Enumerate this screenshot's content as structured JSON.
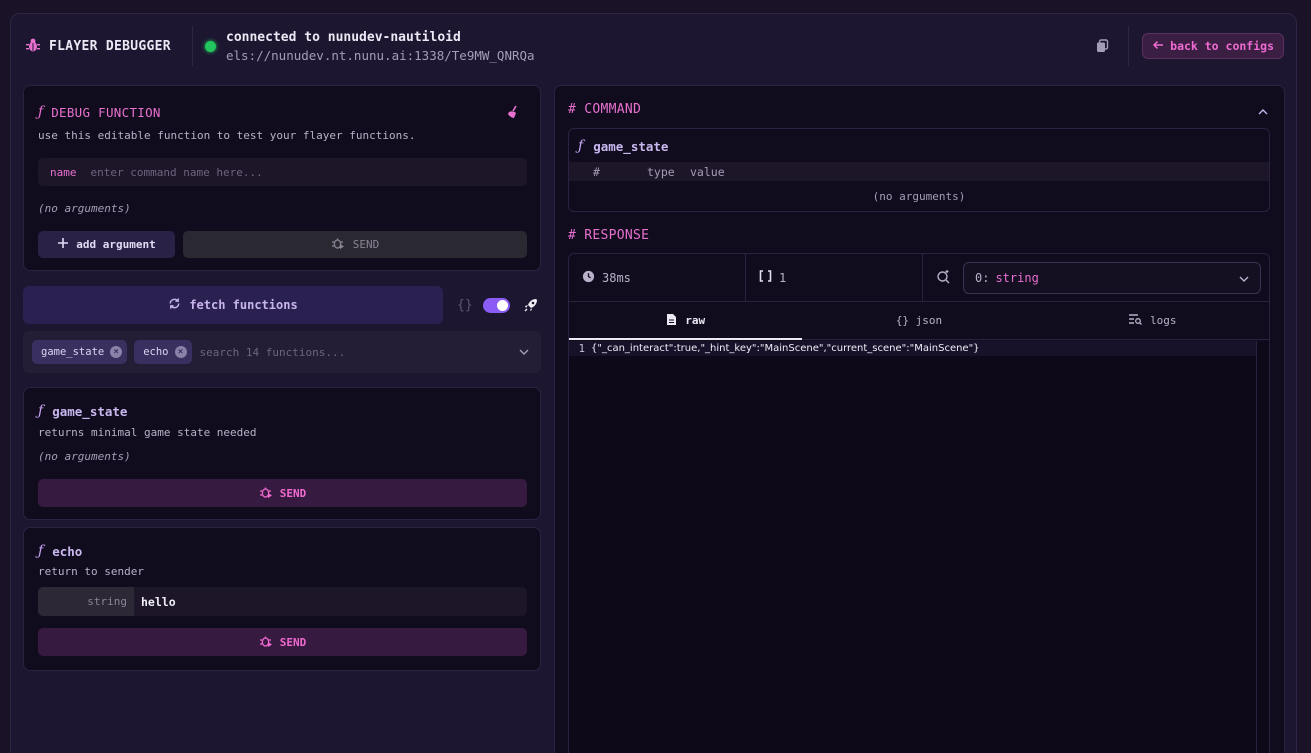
{
  "header": {
    "title": "FLAYER DEBUGGER",
    "connection_title": "connected to nunudev-nautiloid",
    "connection_url": "els://nunudev.nt.nunu.ai:1338/Te9MW_QNRQa",
    "back_label": "back to configs"
  },
  "debug_function": {
    "title": "DEBUG FUNCTION",
    "description": "use this editable function to test your flayer functions.",
    "name_label": "name",
    "name_placeholder": "enter command name here...",
    "no_args": "(no arguments)",
    "add_argument_label": "add argument",
    "send_label": "SEND"
  },
  "fetch": {
    "label": "fetch functions",
    "braces": "{}"
  },
  "filter": {
    "chips": [
      "game_state",
      "echo"
    ],
    "chip_remove": "×",
    "placeholder": "search 14 functions..."
  },
  "functions": [
    {
      "name": "game_state",
      "description": "returns minimal game state needed",
      "no_args": "(no arguments)",
      "send_label": "SEND"
    },
    {
      "name": "echo",
      "description": "return to sender",
      "arg_type": "string",
      "arg_value": "hello",
      "send_label": "SEND"
    }
  ],
  "command": {
    "section_title": "# COMMAND",
    "name": "game_state",
    "col_num": "#",
    "col_type": "type",
    "col_value": "value",
    "no_args": "(no arguments)"
  },
  "response": {
    "section_title": "# RESPONSE",
    "time": "38ms",
    "count": "1",
    "selected_prefix": "0:",
    "selected_type": "string",
    "tabs": [
      "raw",
      "{} json",
      "logs"
    ],
    "line_number": "1",
    "raw_text": "{\"_can_interact\":true,\"_hint_key\":\"MainScene\",\"current_scene\":\"MainScene\"}"
  },
  "colors": {
    "accent_pink": "#e870cf",
    "accent_purple": "#8b5cf6",
    "status_green": "#22c55e"
  }
}
